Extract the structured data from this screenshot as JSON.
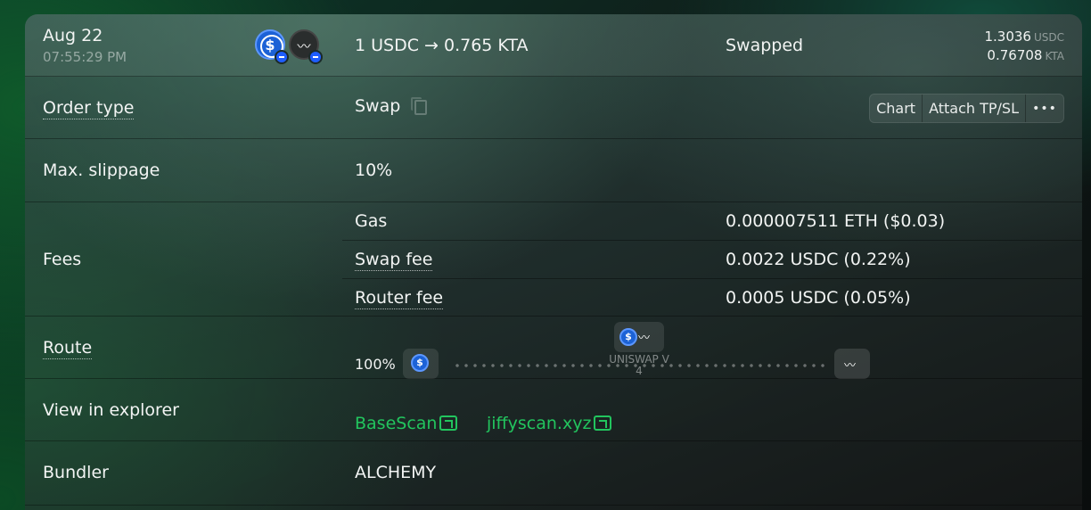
{
  "header": {
    "date": "Aug 22",
    "time": "07:55:29 PM",
    "pair_text": "1 USDC → 0.765 KTA",
    "status": "Swapped",
    "amount_in": "1.3036",
    "amount_in_unit": "USDC",
    "amount_out": "0.76708",
    "amount_out_unit": "KTA",
    "icons": [
      "usdc-coin-icon",
      "kta-coin-icon",
      "base-chain-badge-icon"
    ]
  },
  "order_type": {
    "label": "Order type",
    "value": "Swap",
    "actions": [
      "Chart",
      "Attach TP/SL",
      "•••"
    ]
  },
  "slippage": {
    "label": "Max. slippage",
    "value": "10%"
  },
  "fees": {
    "label": "Fees",
    "items": [
      {
        "name": "Gas",
        "value": "0.000007511 ETH ($0.03)"
      },
      {
        "name": "Swap fee",
        "value": "0.0022 USDC (0.22%)"
      },
      {
        "name": "Router fee",
        "value": "0.0005 USDC (0.05%)"
      }
    ]
  },
  "route": {
    "label": "Route",
    "percent": "100%",
    "dex_line1": "UNISWAP V",
    "dex_line2": "4"
  },
  "explorer": {
    "label": "View in explorer",
    "links": [
      "BaseScan",
      "jiffyscan.xyz"
    ]
  },
  "bundler": {
    "label": "Bundler",
    "value": "ALCHEMY"
  },
  "colors": {
    "link": "#22c55e",
    "usdc": "#1c62d6",
    "badge": "#1e5dff"
  }
}
